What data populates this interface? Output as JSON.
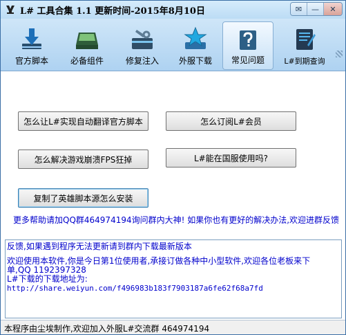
{
  "window": {
    "title": "L# 工具合集 1.1  更新时间-2015年8月10日",
    "controls": {
      "skin": "✉",
      "minimize": "—",
      "close": "✕"
    }
  },
  "toolbar": {
    "items": [
      {
        "label": "官方脚本",
        "icon": "download-icon"
      },
      {
        "label": "必备组件",
        "icon": "tray-icon"
      },
      {
        "label": "修复注入",
        "icon": "wrench-icon"
      },
      {
        "label": "外服下载",
        "icon": "star-icon"
      },
      {
        "label": "常见问题",
        "icon": "help-icon"
      },
      {
        "label": "L#到期查询",
        "icon": "notebook-icon"
      }
    ],
    "active_index": 4
  },
  "faq": {
    "buttons": [
      "怎么让L#实现自动翻译官方脚本",
      "怎么订阅L#会员",
      "怎么解决游戏崩溃FPS狂掉",
      "L#能在国服使用吗?",
      "复制了英雄脚本源怎么安装"
    ],
    "help_text": "更多帮助请加QQ群464974194询问群内大神! 如果你也有更好的解决办法,欢迎进群反馈"
  },
  "info_box": {
    "lines": [
      "反馈,如果遇到程序无法更新请到群内下载最新版本",
      "欢迎使用本软件,你是今日第1位使用者,承接订做各种中小型软件,欢迎各位老板来下",
      "单,QQ 1192397328",
      "L#下载的下载地址为:",
      "http://share.weiyun.com/f496983b183f7903187a6fe62f68a7fd"
    ]
  },
  "statusbar": {
    "text": "本程序由尘埃制作,欢迎加入外服L#交流群 464974194"
  },
  "colors": {
    "link_blue": "#0000cc",
    "toolbar_top": "#cfe6f8",
    "toolbar_bottom": "#aed2f1"
  }
}
